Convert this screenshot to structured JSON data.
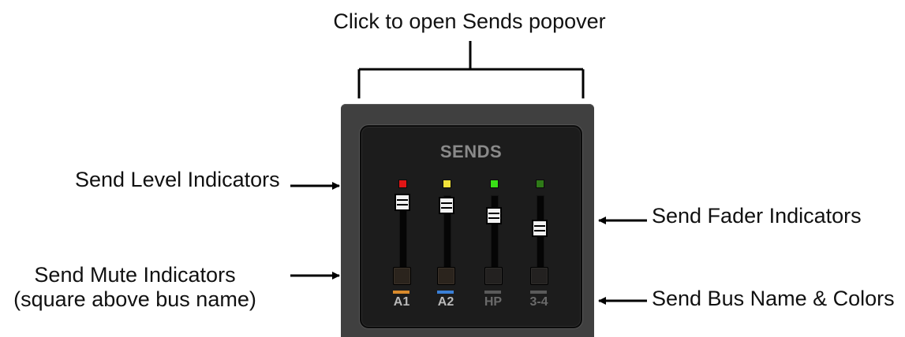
{
  "callouts": {
    "top": "Click to open Sends popover",
    "level": "Send Level Indicators",
    "mute_line1": "Send Mute Indicators",
    "mute_line2": "(square above bus name)",
    "fader": "Send Fader Indicators",
    "bus": "Send Bus Name & Colors"
  },
  "panel": {
    "title": "SENDS",
    "channels": [
      {
        "bus": "A1",
        "led_color": "#e01515",
        "bar_color": "#d98a2b",
        "fader_level": 0.9,
        "muted_style": "active",
        "name_color": "#b9b9b9"
      },
      {
        "bus": "A2",
        "led_color": "#f2e23a",
        "bar_color": "#3a7fd6",
        "fader_level": 0.82,
        "muted_style": "active",
        "name_color": "#b9b9b9"
      },
      {
        "bus": "HP",
        "led_color": "#39e017",
        "bar_color": "#5a5a5a",
        "fader_level": 0.6,
        "muted_style": "dim",
        "name_color": "#6a6a6a"
      },
      {
        "bus": "3-4",
        "led_color": "#2f7a18",
        "bar_color": "#5a5a5a",
        "fader_level": 0.33,
        "muted_style": "dim",
        "name_color": "#6a6a6a"
      }
    ]
  }
}
